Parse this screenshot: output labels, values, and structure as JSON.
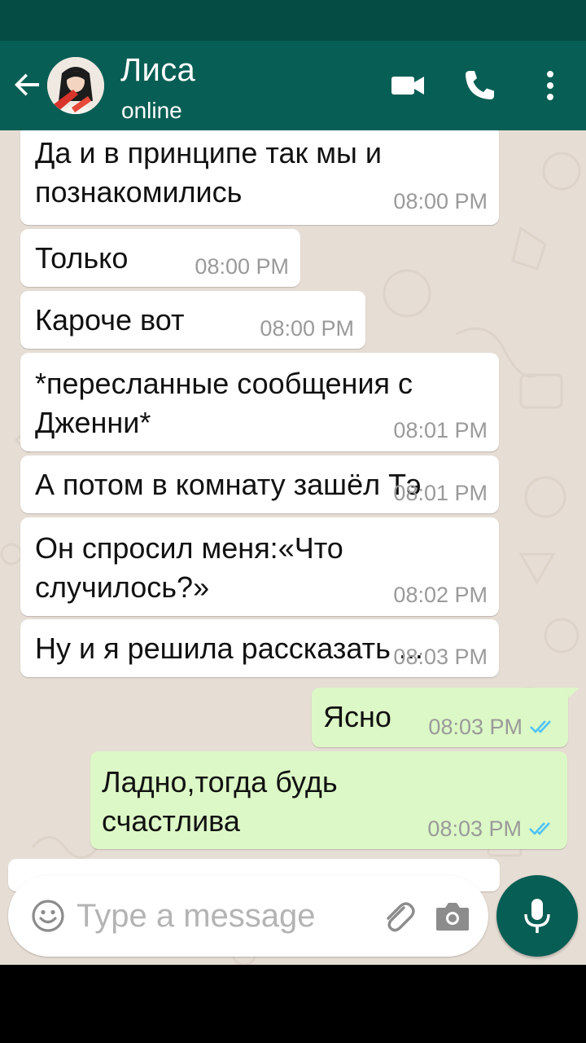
{
  "header": {
    "contact_name": "Лиса",
    "status": "online",
    "icons": [
      "back-arrow-icon",
      "avatar",
      "video-call-icon",
      "phone-call-icon",
      "more-vert-icon"
    ],
    "colors": {
      "appbar": "#075e54",
      "statusbar": "#054d44"
    }
  },
  "messages": [
    {
      "direction": "in",
      "lines": [
        "Да и в принципе так мы и",
        "познакомились"
      ],
      "time": "08:00 PM"
    },
    {
      "direction": "in",
      "lines": [
        "Только"
      ],
      "time": "08:00 PM"
    },
    {
      "direction": "in",
      "lines": [
        "Кароче вот"
      ],
      "time": "08:00 PM"
    },
    {
      "direction": "in",
      "lines": [
        "*пересланные сообщения с",
        "Дженни*"
      ],
      "time": "08:01 PM"
    },
    {
      "direction": "in",
      "lines": [
        "А потом в комнату зашёл Тэ"
      ],
      "time": "08:01 PM"
    },
    {
      "direction": "in",
      "lines": [
        "Он спросил меня:«Что",
        "случилось?»"
      ],
      "time": "08:02 PM"
    },
    {
      "direction": "in",
      "lines": [
        "Ну и я решила рассказать ..."
      ],
      "time": "08:03 PM"
    },
    {
      "direction": "out",
      "lines": [
        "Ясно"
      ],
      "time": "08:03 PM",
      "read": true
    },
    {
      "direction": "out",
      "lines": [
        "Ладно,тогда будь",
        "счастлива"
      ],
      "time": "08:03 PM",
      "read": true
    }
  ],
  "composer": {
    "placeholder": "Type a message",
    "icons": [
      "emoji-icon",
      "attach-icon",
      "camera-icon",
      "mic-icon"
    ]
  },
  "colors": {
    "incoming_bubble": "#ffffff",
    "outgoing_bubble": "#dcf8c6",
    "read_ticks": "#4fc3f7",
    "chat_background": "#e6ddd4",
    "mic_button": "#075e54"
  }
}
